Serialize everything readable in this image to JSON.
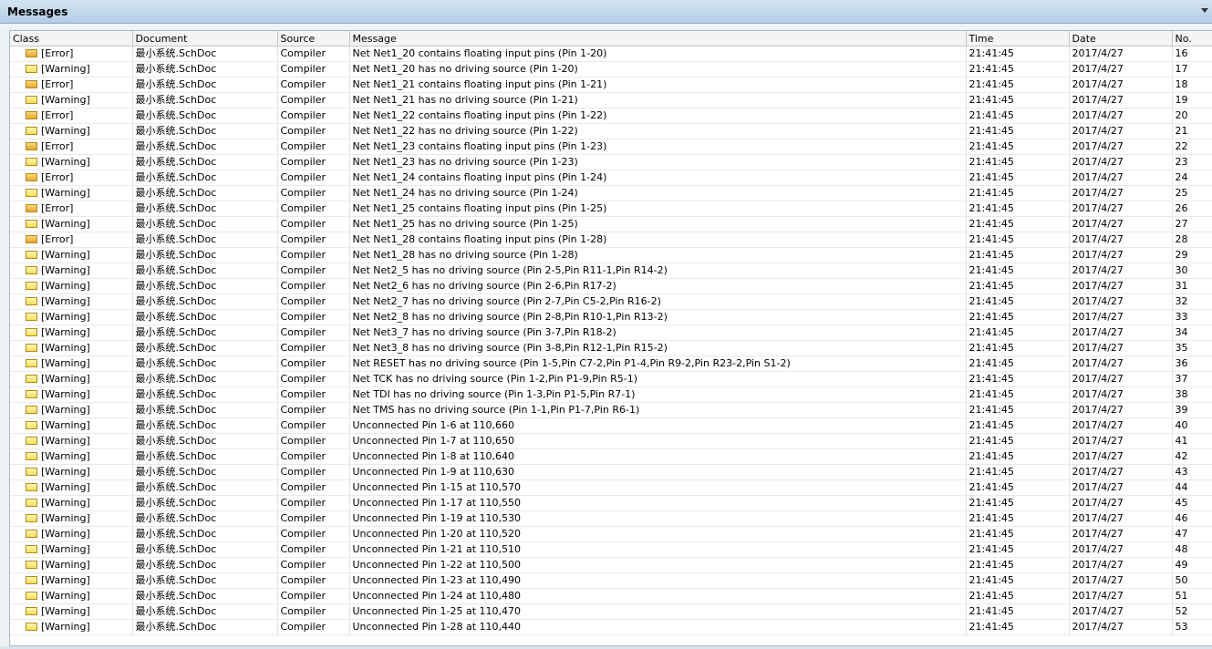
{
  "panel": {
    "title": "Messages"
  },
  "columns": [
    {
      "label": "Class"
    },
    {
      "label": "Document"
    },
    {
      "label": "Source"
    },
    {
      "label": "Message"
    },
    {
      "label": "Time"
    },
    {
      "label": "Date"
    },
    {
      "label": "No."
    }
  ],
  "colors": {
    "error_flag": "#e9a52f",
    "warning_flag": "#f4de5a",
    "header_bg": "#b3cde6"
  },
  "rows": [
    {
      "cls": "[Error]",
      "icon": "error",
      "doc": "最小系统.SchDoc",
      "src": "Compiler",
      "msg": "Net Net1_20 contains floating input pins (Pin 1-20)",
      "time": "21:41:45",
      "date": "2017/4/27",
      "no": "16"
    },
    {
      "cls": "[Warning]",
      "icon": "warning",
      "doc": "最小系统.SchDoc",
      "src": "Compiler",
      "msg": "Net Net1_20 has no driving source (Pin 1-20)",
      "time": "21:41:45",
      "date": "2017/4/27",
      "no": "17"
    },
    {
      "cls": "[Error]",
      "icon": "error",
      "doc": "最小系统.SchDoc",
      "src": "Compiler",
      "msg": "Net Net1_21 contains floating input pins (Pin 1-21)",
      "time": "21:41:45",
      "date": "2017/4/27",
      "no": "18"
    },
    {
      "cls": "[Warning]",
      "icon": "warning",
      "doc": "最小系统.SchDoc",
      "src": "Compiler",
      "msg": "Net Net1_21 has no driving source (Pin 1-21)",
      "time": "21:41:45",
      "date": "2017/4/27",
      "no": "19"
    },
    {
      "cls": "[Error]",
      "icon": "error",
      "doc": "最小系统.SchDoc",
      "src": "Compiler",
      "msg": "Net Net1_22 contains floating input pins (Pin 1-22)",
      "time": "21:41:45",
      "date": "2017/4/27",
      "no": "20"
    },
    {
      "cls": "[Warning]",
      "icon": "warning",
      "doc": "最小系统.SchDoc",
      "src": "Compiler",
      "msg": "Net Net1_22 has no driving source (Pin 1-22)",
      "time": "21:41:45",
      "date": "2017/4/27",
      "no": "21"
    },
    {
      "cls": "[Error]",
      "icon": "error",
      "doc": "最小系统.SchDoc",
      "src": "Compiler",
      "msg": "Net Net1_23 contains floating input pins (Pin 1-23)",
      "time": "21:41:45",
      "date": "2017/4/27",
      "no": "22"
    },
    {
      "cls": "[Warning]",
      "icon": "warning",
      "doc": "最小系统.SchDoc",
      "src": "Compiler",
      "msg": "Net Net1_23 has no driving source (Pin 1-23)",
      "time": "21:41:45",
      "date": "2017/4/27",
      "no": "23"
    },
    {
      "cls": "[Error]",
      "icon": "error",
      "doc": "最小系统.SchDoc",
      "src": "Compiler",
      "msg": "Net Net1_24 contains floating input pins (Pin 1-24)",
      "time": "21:41:45",
      "date": "2017/4/27",
      "no": "24"
    },
    {
      "cls": "[Warning]",
      "icon": "warning",
      "doc": "最小系统.SchDoc",
      "src": "Compiler",
      "msg": "Net Net1_24 has no driving source (Pin 1-24)",
      "time": "21:41:45",
      "date": "2017/4/27",
      "no": "25"
    },
    {
      "cls": "[Error]",
      "icon": "error",
      "doc": "最小系统.SchDoc",
      "src": "Compiler",
      "msg": "Net Net1_25 contains floating input pins (Pin 1-25)",
      "time": "21:41:45",
      "date": "2017/4/27",
      "no": "26"
    },
    {
      "cls": "[Warning]",
      "icon": "warning",
      "doc": "最小系统.SchDoc",
      "src": "Compiler",
      "msg": "Net Net1_25 has no driving source (Pin 1-25)",
      "time": "21:41:45",
      "date": "2017/4/27",
      "no": "27"
    },
    {
      "cls": "[Error]",
      "icon": "error",
      "doc": "最小系统.SchDoc",
      "src": "Compiler",
      "msg": "Net Net1_28 contains floating input pins (Pin 1-28)",
      "time": "21:41:45",
      "date": "2017/4/27",
      "no": "28"
    },
    {
      "cls": "[Warning]",
      "icon": "warning",
      "doc": "最小系统.SchDoc",
      "src": "Compiler",
      "msg": "Net Net1_28 has no driving source (Pin 1-28)",
      "time": "21:41:45",
      "date": "2017/4/27",
      "no": "29"
    },
    {
      "cls": "[Warning]",
      "icon": "warning",
      "doc": "最小系统.SchDoc",
      "src": "Compiler",
      "msg": "Net Net2_5 has no driving source (Pin 2-5,Pin R11-1,Pin R14-2)",
      "time": "21:41:45",
      "date": "2017/4/27",
      "no": "30"
    },
    {
      "cls": "[Warning]",
      "icon": "warning",
      "doc": "最小系统.SchDoc",
      "src": "Compiler",
      "msg": "Net Net2_6 has no driving source (Pin 2-6,Pin R17-2)",
      "time": "21:41:45",
      "date": "2017/4/27",
      "no": "31"
    },
    {
      "cls": "[Warning]",
      "icon": "warning",
      "doc": "最小系统.SchDoc",
      "src": "Compiler",
      "msg": "Net Net2_7 has no driving source (Pin 2-7,Pin C5-2,Pin R16-2)",
      "time": "21:41:45",
      "date": "2017/4/27",
      "no": "32"
    },
    {
      "cls": "[Warning]",
      "icon": "warning",
      "doc": "最小系统.SchDoc",
      "src": "Compiler",
      "msg": "Net Net2_8 has no driving source (Pin 2-8,Pin R10-1,Pin R13-2)",
      "time": "21:41:45",
      "date": "2017/4/27",
      "no": "33"
    },
    {
      "cls": "[Warning]",
      "icon": "warning",
      "doc": "最小系统.SchDoc",
      "src": "Compiler",
      "msg": "Net Net3_7 has no driving source (Pin 3-7,Pin R18-2)",
      "time": "21:41:45",
      "date": "2017/4/27",
      "no": "34"
    },
    {
      "cls": "[Warning]",
      "icon": "warning",
      "doc": "最小系统.SchDoc",
      "src": "Compiler",
      "msg": "Net Net3_8 has no driving source (Pin 3-8,Pin R12-1,Pin R15-2)",
      "time": "21:41:45",
      "date": "2017/4/27",
      "no": "35"
    },
    {
      "cls": "[Warning]",
      "icon": "warning",
      "doc": "最小系统.SchDoc",
      "src": "Compiler",
      "msg": "Net RESET has no driving source (Pin 1-5,Pin C7-2,Pin P1-4,Pin R9-2,Pin R23-2,Pin S1-2)",
      "time": "21:41:45",
      "date": "2017/4/27",
      "no": "36"
    },
    {
      "cls": "[Warning]",
      "icon": "warning",
      "doc": "最小系统.SchDoc",
      "src": "Compiler",
      "msg": "Net TCK has no driving source (Pin 1-2,Pin P1-9,Pin R5-1)",
      "time": "21:41:45",
      "date": "2017/4/27",
      "no": "37"
    },
    {
      "cls": "[Warning]",
      "icon": "warning",
      "doc": "最小系统.SchDoc",
      "src": "Compiler",
      "msg": "Net TDI has no driving source (Pin 1-3,Pin P1-5,Pin R7-1)",
      "time": "21:41:45",
      "date": "2017/4/27",
      "no": "38"
    },
    {
      "cls": "[Warning]",
      "icon": "warning",
      "doc": "最小系统.SchDoc",
      "src": "Compiler",
      "msg": "Net TMS has no driving source (Pin 1-1,Pin P1-7,Pin R6-1)",
      "time": "21:41:45",
      "date": "2017/4/27",
      "no": "39"
    },
    {
      "cls": "[Warning]",
      "icon": "warning",
      "doc": "最小系统.SchDoc",
      "src": "Compiler",
      "msg": "Unconnected Pin 1-6 at 110,660",
      "time": "21:41:45",
      "date": "2017/4/27",
      "no": "40"
    },
    {
      "cls": "[Warning]",
      "icon": "warning",
      "doc": "最小系统.SchDoc",
      "src": "Compiler",
      "msg": "Unconnected Pin 1-7 at 110,650",
      "time": "21:41:45",
      "date": "2017/4/27",
      "no": "41"
    },
    {
      "cls": "[Warning]",
      "icon": "warning",
      "doc": "最小系统.SchDoc",
      "src": "Compiler",
      "msg": "Unconnected Pin 1-8 at 110,640",
      "time": "21:41:45",
      "date": "2017/4/27",
      "no": "42"
    },
    {
      "cls": "[Warning]",
      "icon": "warning",
      "doc": "最小系统.SchDoc",
      "src": "Compiler",
      "msg": "Unconnected Pin 1-9 at 110,630",
      "time": "21:41:45",
      "date": "2017/4/27",
      "no": "43"
    },
    {
      "cls": "[Warning]",
      "icon": "warning",
      "doc": "最小系统.SchDoc",
      "src": "Compiler",
      "msg": "Unconnected Pin 1-15 at 110,570",
      "time": "21:41:45",
      "date": "2017/4/27",
      "no": "44"
    },
    {
      "cls": "[Warning]",
      "icon": "warning",
      "doc": "最小系统.SchDoc",
      "src": "Compiler",
      "msg": "Unconnected Pin 1-17 at 110,550",
      "time": "21:41:45",
      "date": "2017/4/27",
      "no": "45"
    },
    {
      "cls": "[Warning]",
      "icon": "warning",
      "doc": "最小系统.SchDoc",
      "src": "Compiler",
      "msg": "Unconnected Pin 1-19 at 110,530",
      "time": "21:41:45",
      "date": "2017/4/27",
      "no": "46"
    },
    {
      "cls": "[Warning]",
      "icon": "warning",
      "doc": "最小系统.SchDoc",
      "src": "Compiler",
      "msg": "Unconnected Pin 1-20 at 110,520",
      "time": "21:41:45",
      "date": "2017/4/27",
      "no": "47"
    },
    {
      "cls": "[Warning]",
      "icon": "warning",
      "doc": "最小系统.SchDoc",
      "src": "Compiler",
      "msg": "Unconnected Pin 1-21 at 110,510",
      "time": "21:41:45",
      "date": "2017/4/27",
      "no": "48"
    },
    {
      "cls": "[Warning]",
      "icon": "warning",
      "doc": "最小系统.SchDoc",
      "src": "Compiler",
      "msg": "Unconnected Pin 1-22 at 110,500",
      "time": "21:41:45",
      "date": "2017/4/27",
      "no": "49"
    },
    {
      "cls": "[Warning]",
      "icon": "warning",
      "doc": "最小系统.SchDoc",
      "src": "Compiler",
      "msg": "Unconnected Pin 1-23 at 110,490",
      "time": "21:41:45",
      "date": "2017/4/27",
      "no": "50"
    },
    {
      "cls": "[Warning]",
      "icon": "warning",
      "doc": "最小系统.SchDoc",
      "src": "Compiler",
      "msg": "Unconnected Pin 1-24 at 110,480",
      "time": "21:41:45",
      "date": "2017/4/27",
      "no": "51"
    },
    {
      "cls": "[Warning]",
      "icon": "warning",
      "doc": "最小系统.SchDoc",
      "src": "Compiler",
      "msg": "Unconnected Pin 1-25 at 110,470",
      "time": "21:41:45",
      "date": "2017/4/27",
      "no": "52"
    },
    {
      "cls": "[Warning]",
      "icon": "warning",
      "doc": "最小系统.SchDoc",
      "src": "Compiler",
      "msg": "Unconnected Pin 1-28 at 110,440",
      "time": "21:41:45",
      "date": "2017/4/27",
      "no": "53"
    }
  ]
}
